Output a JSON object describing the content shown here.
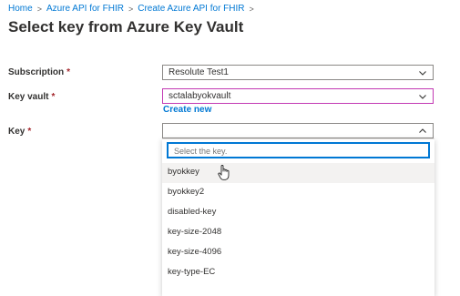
{
  "breadcrumb": {
    "items": [
      "Home",
      "Azure API for FHIR",
      "Create Azure API for FHIR"
    ],
    "separator": ">"
  },
  "page": {
    "title": "Select key from Azure Key Vault"
  },
  "form": {
    "subscription": {
      "label": "Subscription",
      "required": "*",
      "value": "Resolute Test1"
    },
    "key_vault": {
      "label": "Key vault",
      "required": "*",
      "value": "sctalabyokvault",
      "create_new": "Create new"
    },
    "key": {
      "label": "Key",
      "required": "*",
      "value": ""
    }
  },
  "dropdown": {
    "filter_placeholder": "Select the key.",
    "options": [
      "byokkey",
      "byokkey2",
      "disabled-key",
      "key-size-2048",
      "key-size-4096",
      "key-type-EC"
    ],
    "hovered_option": "byokkey"
  },
  "colors": {
    "link": "#0078d4",
    "required": "#a4262c",
    "focus_border": "#c239b3",
    "hover_bg": "#f3f2f1"
  },
  "icons": {
    "select_arrow": "chevron-down-icon",
    "open_arrow": "chevron-up-icon",
    "cursor": "hand-pointer-icon"
  }
}
